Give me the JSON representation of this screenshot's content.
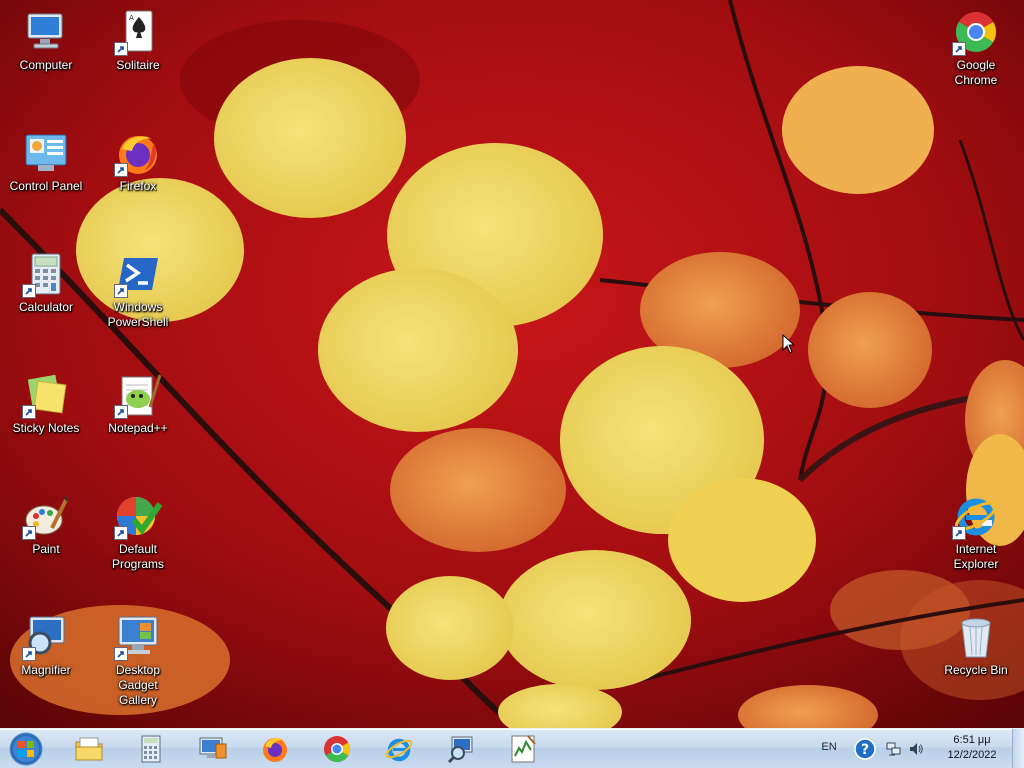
{
  "desktop": {
    "icons_left": [
      {
        "label": "Computer",
        "icon": "computer-icon"
      },
      {
        "label": "Control Panel",
        "icon": "control-panel-icon"
      },
      {
        "label": "Calculator",
        "icon": "calculator-icon"
      },
      {
        "label": "Sticky Notes",
        "icon": "sticky-notes-icon"
      },
      {
        "label": "Paint",
        "icon": "paint-icon"
      },
      {
        "label": "Magnifier",
        "icon": "magnifier-icon"
      }
    ],
    "icons_col2": [
      {
        "label": "Solitaire",
        "icon": "solitaire-icon"
      },
      {
        "label": "Firefox",
        "icon": "firefox-icon"
      },
      {
        "label": "Windows PowerShell",
        "icon": "powershell-icon"
      },
      {
        "label": "Notepad++",
        "icon": "notepadpp-icon"
      },
      {
        "label": "Default Programs",
        "icon": "default-programs-icon"
      },
      {
        "label": "Desktop Gadget Gallery",
        "icon": "gadget-gallery-icon"
      }
    ],
    "icons_right": [
      {
        "label": "Google Chrome",
        "icon": "chrome-icon"
      },
      {
        "label": "Internet Explorer",
        "icon": "ie-icon"
      },
      {
        "label": "Recycle Bin",
        "icon": "recycle-bin-icon"
      }
    ]
  },
  "taskbar": {
    "start": "start-orb-icon",
    "pinned": [
      "file-explorer-icon",
      "calculator-icon",
      "remote-desktop-icon",
      "firefox-icon",
      "chrome-icon",
      "ie-icon",
      "magnifier-icon",
      "task-manager-icon"
    ],
    "tray": {
      "language": "EN",
      "time": "6:51 μμ",
      "date": "12/2/2022"
    }
  },
  "colors": {
    "wallpaper_bg": "#8b0a0a",
    "taskbar": "#c8daee"
  }
}
